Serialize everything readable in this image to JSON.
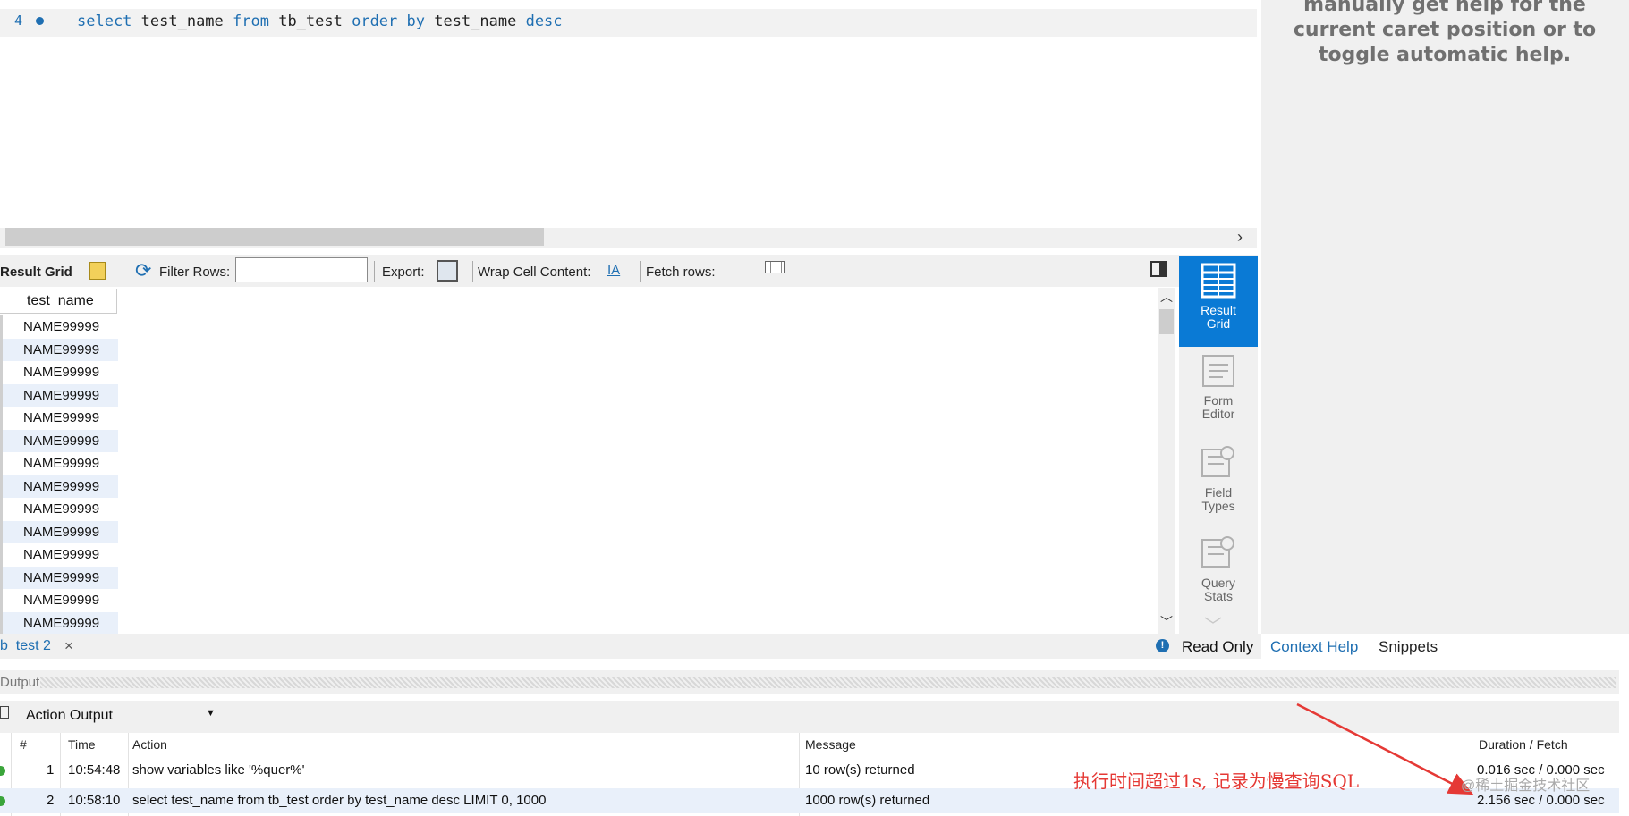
{
  "editor": {
    "line_number": "4",
    "tokens": [
      {
        "text": "select",
        "kw": true
      },
      {
        "text": " test_name ",
        "kw": false
      },
      {
        "text": "from",
        "kw": true
      },
      {
        "text": " tb_test ",
        "kw": false
      },
      {
        "text": "order by",
        "kw": true
      },
      {
        "text": " test_name ",
        "kw": false
      },
      {
        "text": "desc",
        "kw": true
      }
    ]
  },
  "help": {
    "text": "manually get help for the current caret position or to toggle automatic help."
  },
  "result_toolbar": {
    "title": "Result Grid",
    "filter_label": "Filter Rows:",
    "filter_value": "",
    "export_label": "Export:",
    "wrap_label": "Wrap Cell Content:",
    "fetch_label": "Fetch rows:"
  },
  "grid": {
    "column": "test_name",
    "rows": [
      "NAME99999",
      "NAME99999",
      "NAME99999",
      "NAME99999",
      "NAME99999",
      "NAME99999",
      "NAME99999",
      "NAME99999",
      "NAME99999",
      "NAME99999",
      "NAME99999",
      "NAME99999",
      "NAME99999",
      "NAME99999"
    ]
  },
  "side_panel": {
    "result_grid": "Result Grid",
    "form_editor": "Form Editor",
    "field_types": "Field Types",
    "query_stats": "Query Stats"
  },
  "tabs": {
    "query_tab": "b_test 2",
    "read_only": "Read Only",
    "context_help": "Context Help",
    "snippets": "Snippets"
  },
  "output": {
    "label": "Dutput",
    "selector": "Action Output",
    "columns": [
      "#",
      "Time",
      "Action",
      "Message",
      "Duration / Fetch"
    ],
    "rows": [
      {
        "num": "1",
        "time": "10:54:48",
        "action": "show variables like '%quer%'",
        "message": "10 row(s) returned",
        "duration": "0.016 sec / 0.000 sec"
      },
      {
        "num": "2",
        "time": "10:58:10",
        "action": "select test_name from tb_test order by test_name desc LIMIT 0, 1000",
        "message": "1000 row(s) returned",
        "duration": "2.156 sec / 0.000 sec"
      }
    ]
  },
  "annotation": {
    "text": "执行时间超过1s, 记录为慢查询SQL",
    "watermark": "@稀土掘金技术社区",
    "color": "#e53935"
  },
  "colors": {
    "accent": "#0a7ad5",
    "keyword": "#1f6fb2",
    "ok": "#3aa53a"
  }
}
